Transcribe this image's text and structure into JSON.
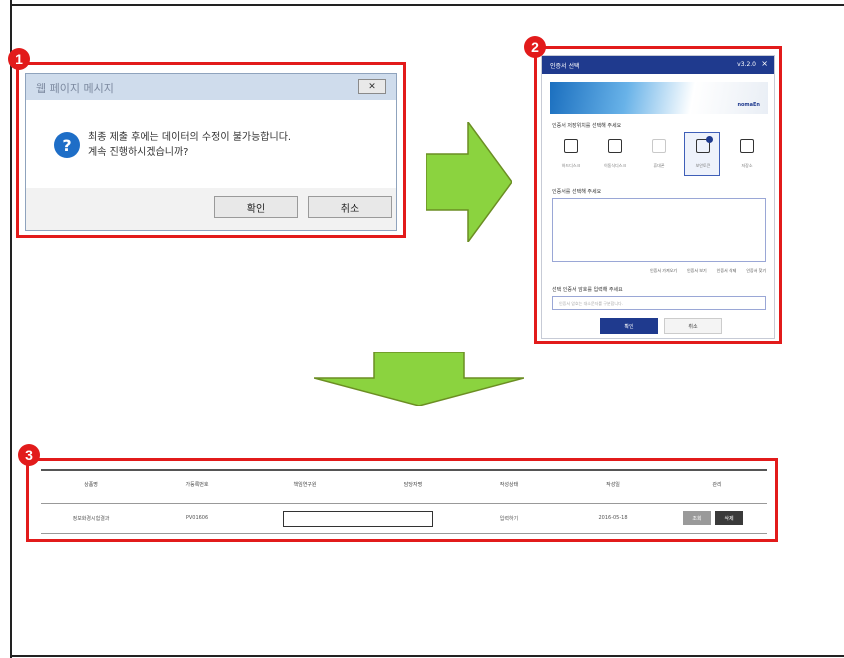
{
  "steps": [
    "1",
    "2",
    "3"
  ],
  "dialog1": {
    "title": "웹 페이지 메시지",
    "close_label": "✕",
    "message_line1": "최종 제출 후에는 데이터의 수정이 불가능합니다.",
    "message_line2": "계속 진행하시겠습니까?",
    "ok_label": "확인",
    "cancel_label": "취소"
  },
  "dialog2": {
    "title": "인증서 선택",
    "version": "v3.2.0",
    "close_label": "×",
    "brand": "nomaEn",
    "location_label": "인증서 저장위치를 선택해 주세요",
    "locations": [
      {
        "label": "하드디스크",
        "selected": false,
        "disabled": false
      },
      {
        "label": "이동식디스크",
        "selected": false,
        "disabled": false
      },
      {
        "label": "휴대폰",
        "selected": false,
        "disabled": true
      },
      {
        "label": "보안토큰",
        "selected": true,
        "disabled": false
      },
      {
        "label": "저장소",
        "selected": false,
        "disabled": false
      }
    ],
    "cert_list_label": "인증서를 선택해 주세요",
    "options": [
      "인증서 가져오기",
      "인증서 보기",
      "인증서 삭제",
      "인증서 찾기"
    ],
    "password_label": "선택 인증서 암호를 입력해 주세요",
    "password_placeholder": "인증서 암호는 대소문자를 구분합니다.",
    "ok_label": "확인",
    "cancel_label": "취소"
  },
  "table": {
    "headers": [
      "상품명",
      "가등록번호",
      "책임연구원",
      "담당자명",
      "작성상태",
      "작성일",
      "관리"
    ],
    "row": {
      "product": "정보화경시험결과",
      "reg_no": "PV01606",
      "researcher": "",
      "manager": "",
      "status": "입력하기",
      "date": "2016-05-18",
      "view_label": "조회",
      "delete_label": "삭제"
    }
  },
  "colors": {
    "highlight_red": "#e21b1b",
    "arrow_green": "#8bd33f",
    "dialog_blue": "#1f3a8e"
  }
}
